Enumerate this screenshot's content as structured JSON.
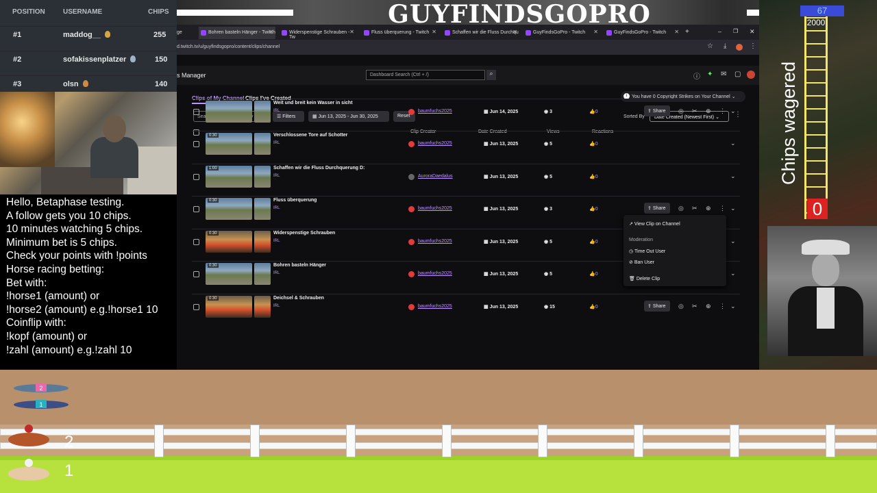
{
  "leaderboard": {
    "headers": {
      "position": "POSITION",
      "username": "USERNAME",
      "chips": "CHIPS"
    },
    "rows": [
      {
        "position": "#1",
        "username": "maddog__",
        "chips": "255"
      },
      {
        "position": "#2",
        "username": "sofakissenplatzer",
        "chips": "150"
      },
      {
        "position": "#3",
        "username": "olsn",
        "chips": "140"
      }
    ]
  },
  "info_text": "Hello, Betaphase testing.\nA follow gets you 10 chips.\n10 minutes watching 5 chips.\nMinimum bet is 5 chips.\nCheck your points with !points\nHorse racing betting:\nBet with:\n!horse1 (amount) or\n!horse2 (amount) e.g.!horse1 10\nCoinflip with:\n!kopf (amount) or\n!zahl (amount) e.g.!zahl 10",
  "stream_title": "GUYFINDSGOPRO",
  "browser": {
    "tabs": [
      {
        "label": "ge"
      },
      {
        "label": "Bohren basteln Hänger - Twitch"
      },
      {
        "label": "Widerspenstige Schrauben - Tw"
      },
      {
        "label": "Fluss überquerung - Twitch"
      },
      {
        "label": "Schaffen wir die Fluss Durchqu"
      },
      {
        "label": "GuyFindsGoPro - Twitch"
      },
      {
        "label": "GuyFindsGoPro - Twitch"
      }
    ],
    "url": "d.twitch.tv/u/guyfindsgopro/content/clips/channel",
    "page_name": "s Manager",
    "search_placeholder": "Dashboard Search (Ctrl + /)"
  },
  "clips": {
    "subtabs": [
      "Clips of My Channel",
      "Clips I've Created"
    ],
    "copyright": "You have 0 Copyright Strikes on Your Channel",
    "filter_placeholder": "Search by title or category",
    "filters_label": "Filters",
    "date_range": "Jun 13, 2025 - Jun 30, 2025",
    "reset_label": "Reset",
    "sorted_by_label": "Sorted By",
    "sort_value": "Date Created (Newest First)",
    "columns": [
      "Clip Creator",
      "Date Created",
      "Views",
      "Reactions"
    ],
    "share_label": "Share",
    "rows": [
      {
        "duration": "",
        "title": "Weit und breit kein Wasser in sicht",
        "category": "IRL",
        "creator": "baumfuchs2025",
        "date": "Jun 14, 2025",
        "views": "3",
        "reactions": "0"
      },
      {
        "duration": "0:30",
        "title": "Verschlossene Tore auf Schotter",
        "category": "IRL",
        "creator": "baumfuchs2025",
        "date": "Jun 13, 2025",
        "views": "5",
        "reactions": "0"
      },
      {
        "duration": "1:00",
        "title": "Schaffen wir die Fluss Durchquerung D:",
        "category": "IRL",
        "creator": "AuroraDaedalus",
        "date": "Jun 13, 2025",
        "views": "5",
        "reactions": "0"
      },
      {
        "duration": "0:30",
        "title": "Fluss überquerung",
        "category": "IRL",
        "creator": "baumfuchs2025",
        "date": "Jun 13, 2025",
        "views": "3",
        "reactions": "0"
      },
      {
        "duration": "0:30",
        "title": "Widerspenstige Schrauben",
        "category": "IRL",
        "creator": "baumfuchs2025",
        "date": "Jun 13, 2025",
        "views": "5",
        "reactions": "0"
      },
      {
        "duration": "0:30",
        "title": "Bohren basteln Hänger",
        "category": "IRL",
        "creator": "baumfuchs2025",
        "date": "Jun 13, 2025",
        "views": "5",
        "reactions": "0"
      },
      {
        "duration": "0:30",
        "title": "Deichsel & Schrauben",
        "category": "IRL",
        "creator": "baumfuchs2025",
        "date": "Jun 13, 2025",
        "views": "15",
        "reactions": "0"
      }
    ],
    "menu": {
      "view": "View Clip on Channel",
      "moderation": "Moderation",
      "timeout": "Time Out User",
      "ban": "Ban User",
      "delete": "Delete Clip"
    }
  },
  "chips_panel": {
    "count": "67",
    "max": "2000",
    "label": "Chips wagered",
    "value": "0"
  },
  "race": {
    "horse_numbers": [
      "2",
      "1"
    ],
    "dog_numbers": [
      "2",
      "1"
    ]
  }
}
